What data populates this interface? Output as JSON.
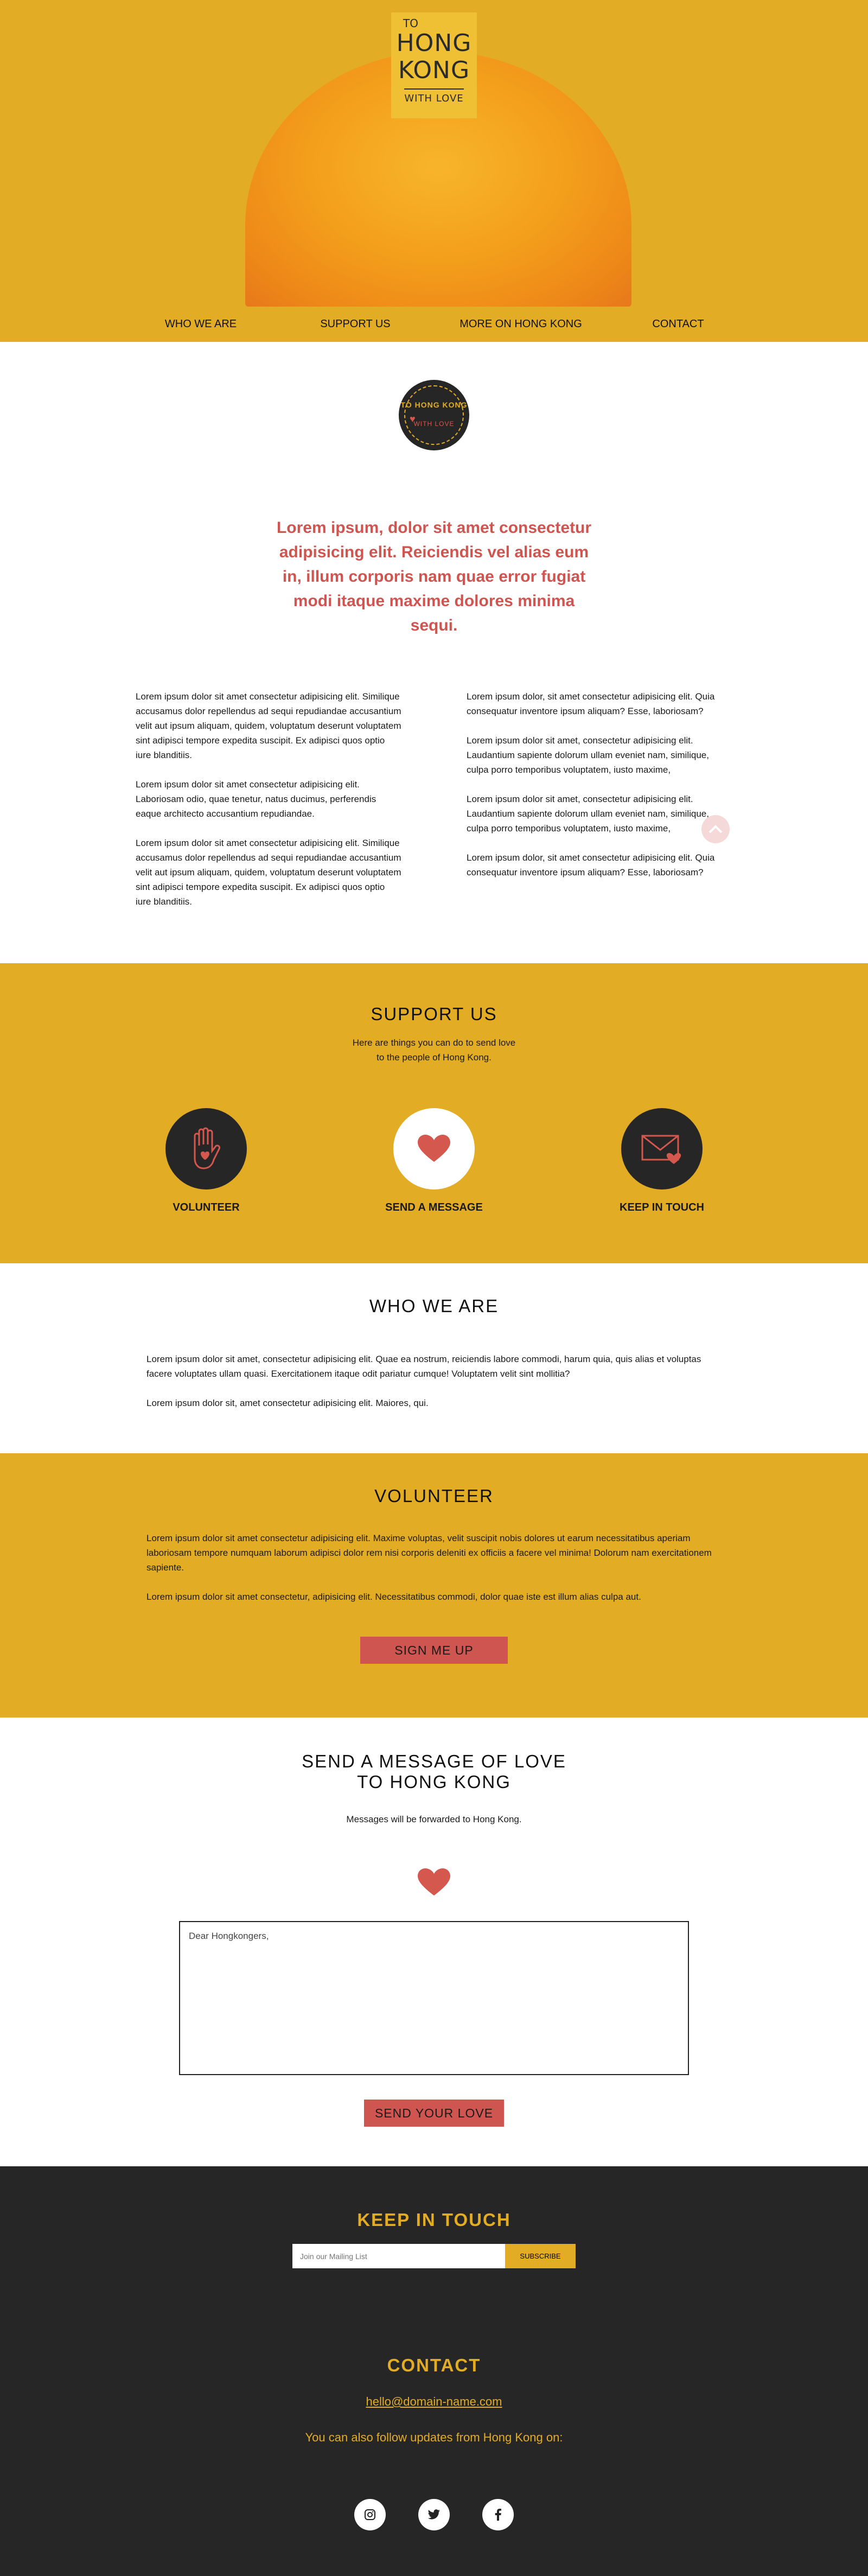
{
  "logo": {
    "line1": "TO",
    "line2": "HONG",
    "line3": "KONG",
    "line4": "WITH LOVE"
  },
  "nav": [
    "WHO WE ARE",
    "SUPPORT US",
    "MORE ON HONG KONG",
    "CONTACT"
  ],
  "badge": {
    "text_top": "TO HONG KONG",
    "text_bottom": "WITH LOVE"
  },
  "intro": {
    "lead": "Lorem ipsum, dolor sit amet consectetur adipisicing elit. Reiciendis vel alias eum in, illum corporis nam quae error fugiat modi itaque maxime dolores minima sequi.",
    "left": [
      "Lorem ipsum dolor sit amet consectetur adipisicing elit. Similique accusamus dolor repellendus ad sequi repudiandae accusantium velit aut ipsum aliquam, quidem, voluptatum deserunt voluptatem sint adipisci tempore expedita suscipit. Ex adipisci quos optio iure blanditiis.",
      "Lorem ipsum dolor sit amet consectetur adipisicing elit. Laboriosam odio, quae tenetur, natus ducimus, perferendis eaque architecto accusantium repudiandae.",
      "Lorem ipsum dolor sit amet consectetur adipisicing elit. Similique accusamus dolor repellendus ad sequi repudiandae accusantium velit aut ipsum aliquam, quidem, voluptatum deserunt voluptatem sint adipisci tempore expedita suscipit. Ex adipisci quos optio iure blanditiis."
    ],
    "right": [
      "Lorem ipsum dolor, sit amet consectetur adipisicing elit. Quia consequatur inventore ipsum aliquam? Esse, laboriosam?",
      "Lorem ipsum dolor sit amet, consectetur adipisicing elit. Laudantium sapiente dolorum ullam eveniet nam, similique, culpa porro temporibus voluptatem, iusto maxime,",
      "Lorem ipsum dolor sit amet, consectetur adipisicing elit. Laudantium sapiente dolorum ullam eveniet nam, similique, culpa porro temporibus voluptatem, iusto maxime,",
      "Lorem ipsum dolor, sit amet consectetur adipisicing elit. Quia consequatur inventore ipsum aliquam? Esse, laboriosam?"
    ]
  },
  "support": {
    "title": "SUPPORT US",
    "subtitle_1": "Here are things you can do to send love",
    "subtitle_2": "to the people of Hong Kong.",
    "items": [
      {
        "label": "VOLUNTEER",
        "icon": "hand-heart-icon"
      },
      {
        "label": "SEND A MESSAGE",
        "icon": "heart-icon"
      },
      {
        "label": "KEEP IN TOUCH",
        "icon": "envelope-heart-icon"
      }
    ]
  },
  "who": {
    "title": "WHO WE ARE",
    "p1": "Lorem ipsum dolor sit amet, consectetur adipisicing elit. Quae ea nostrum, reiciendis labore commodi, harum quia, quis alias et voluptas facere voluptates ullam quasi. Exercitationem itaque odit pariatur cumque! Voluptatem velit sint mollitia?",
    "p2": "Lorem ipsum dolor sit, amet consectetur adipisicing elit. Maiores, qui."
  },
  "volunteer": {
    "title": "VOLUNTEER",
    "p1": "Lorem ipsum dolor sit amet consectetur adipisicing elit. Maxime voluptas, velit suscipit nobis dolores ut earum necessitatibus aperiam laboriosam tempore numquam laborum adipisci dolor rem nisi corporis deleniti ex officiis a facere vel minima! Dolorum nam exercitationem sapiente.",
    "p2": "Lorem ipsum dolor sit amet consectetur, adipisicing elit. Necessitatibus commodi, dolor quae iste est illum alias culpa aut.",
    "button": "SIGN ME UP"
  },
  "message": {
    "title_1": "SEND A MESSAGE OF LOVE",
    "title_2": "TO HONG KONG",
    "subtitle": "Messages will be forwarded to Hong Kong.",
    "placeholder": "Dear Hongkongers,",
    "button": "SEND YOUR LOVE"
  },
  "keep": {
    "title": "KEEP IN TOUCH",
    "placeholder": "Join our Mailing List",
    "button": "SUBSCRIBE"
  },
  "contact": {
    "title": "CONTACT",
    "email": "hello@domain-name.com",
    "follow": "You can also follow updates from Hong Kong on:",
    "social": [
      "instagram-icon",
      "twitter-icon",
      "facebook-icon"
    ]
  },
  "colors": {
    "yellow": "#e3ac25",
    "coral": "#cf5550",
    "dark": "#262626"
  }
}
